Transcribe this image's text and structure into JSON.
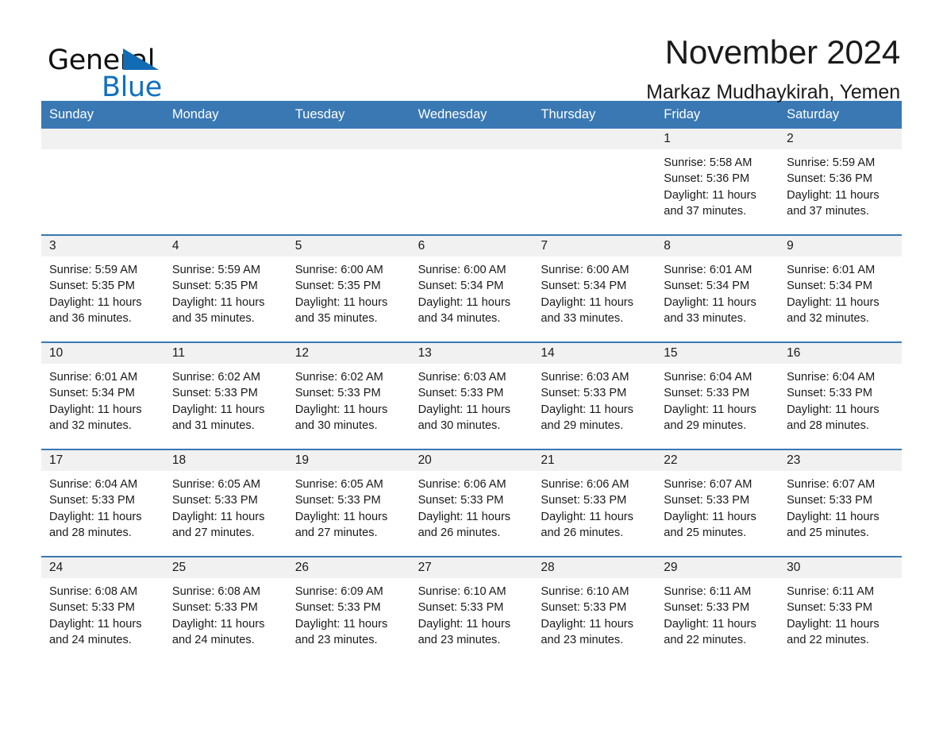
{
  "brand": {
    "word_general": "General",
    "word_blue": "Blue",
    "triangle_icon": "triangle-icon",
    "accent_color": "#126cb5"
  },
  "header": {
    "month_title": "November 2024",
    "location": "Markaz Mudhaykirah, Yemen"
  },
  "calendar": {
    "header_color": "#3a78b4",
    "weekdays": [
      "Sunday",
      "Monday",
      "Tuesday",
      "Wednesday",
      "Thursday",
      "Friday",
      "Saturday"
    ],
    "weeks": [
      [
        {
          "day": "",
          "lines": []
        },
        {
          "day": "",
          "lines": []
        },
        {
          "day": "",
          "lines": []
        },
        {
          "day": "",
          "lines": []
        },
        {
          "day": "",
          "lines": []
        },
        {
          "day": "1",
          "lines": [
            "Sunrise: 5:58 AM",
            "Sunset: 5:36 PM",
            "Daylight: 11 hours",
            "and 37 minutes."
          ]
        },
        {
          "day": "2",
          "lines": [
            "Sunrise: 5:59 AM",
            "Sunset: 5:36 PM",
            "Daylight: 11 hours",
            "and 37 minutes."
          ]
        }
      ],
      [
        {
          "day": "3",
          "lines": [
            "Sunrise: 5:59 AM",
            "Sunset: 5:35 PM",
            "Daylight: 11 hours",
            "and 36 minutes."
          ]
        },
        {
          "day": "4",
          "lines": [
            "Sunrise: 5:59 AM",
            "Sunset: 5:35 PM",
            "Daylight: 11 hours",
            "and 35 minutes."
          ]
        },
        {
          "day": "5",
          "lines": [
            "Sunrise: 6:00 AM",
            "Sunset: 5:35 PM",
            "Daylight: 11 hours",
            "and 35 minutes."
          ]
        },
        {
          "day": "6",
          "lines": [
            "Sunrise: 6:00 AM",
            "Sunset: 5:34 PM",
            "Daylight: 11 hours",
            "and 34 minutes."
          ]
        },
        {
          "day": "7",
          "lines": [
            "Sunrise: 6:00 AM",
            "Sunset: 5:34 PM",
            "Daylight: 11 hours",
            "and 33 minutes."
          ]
        },
        {
          "day": "8",
          "lines": [
            "Sunrise: 6:01 AM",
            "Sunset: 5:34 PM",
            "Daylight: 11 hours",
            "and 33 minutes."
          ]
        },
        {
          "day": "9",
          "lines": [
            "Sunrise: 6:01 AM",
            "Sunset: 5:34 PM",
            "Daylight: 11 hours",
            "and 32 minutes."
          ]
        }
      ],
      [
        {
          "day": "10",
          "lines": [
            "Sunrise: 6:01 AM",
            "Sunset: 5:34 PM",
            "Daylight: 11 hours",
            "and 32 minutes."
          ]
        },
        {
          "day": "11",
          "lines": [
            "Sunrise: 6:02 AM",
            "Sunset: 5:33 PM",
            "Daylight: 11 hours",
            "and 31 minutes."
          ]
        },
        {
          "day": "12",
          "lines": [
            "Sunrise: 6:02 AM",
            "Sunset: 5:33 PM",
            "Daylight: 11 hours",
            "and 30 minutes."
          ]
        },
        {
          "day": "13",
          "lines": [
            "Sunrise: 6:03 AM",
            "Sunset: 5:33 PM",
            "Daylight: 11 hours",
            "and 30 minutes."
          ]
        },
        {
          "day": "14",
          "lines": [
            "Sunrise: 6:03 AM",
            "Sunset: 5:33 PM",
            "Daylight: 11 hours",
            "and 29 minutes."
          ]
        },
        {
          "day": "15",
          "lines": [
            "Sunrise: 6:04 AM",
            "Sunset: 5:33 PM",
            "Daylight: 11 hours",
            "and 29 minutes."
          ]
        },
        {
          "day": "16",
          "lines": [
            "Sunrise: 6:04 AM",
            "Sunset: 5:33 PM",
            "Daylight: 11 hours",
            "and 28 minutes."
          ]
        }
      ],
      [
        {
          "day": "17",
          "lines": [
            "Sunrise: 6:04 AM",
            "Sunset: 5:33 PM",
            "Daylight: 11 hours",
            "and 28 minutes."
          ]
        },
        {
          "day": "18",
          "lines": [
            "Sunrise: 6:05 AM",
            "Sunset: 5:33 PM",
            "Daylight: 11 hours",
            "and 27 minutes."
          ]
        },
        {
          "day": "19",
          "lines": [
            "Sunrise: 6:05 AM",
            "Sunset: 5:33 PM",
            "Daylight: 11 hours",
            "and 27 minutes."
          ]
        },
        {
          "day": "20",
          "lines": [
            "Sunrise: 6:06 AM",
            "Sunset: 5:33 PM",
            "Daylight: 11 hours",
            "and 26 minutes."
          ]
        },
        {
          "day": "21",
          "lines": [
            "Sunrise: 6:06 AM",
            "Sunset: 5:33 PM",
            "Daylight: 11 hours",
            "and 26 minutes."
          ]
        },
        {
          "day": "22",
          "lines": [
            "Sunrise: 6:07 AM",
            "Sunset: 5:33 PM",
            "Daylight: 11 hours",
            "and 25 minutes."
          ]
        },
        {
          "day": "23",
          "lines": [
            "Sunrise: 6:07 AM",
            "Sunset: 5:33 PM",
            "Daylight: 11 hours",
            "and 25 minutes."
          ]
        }
      ],
      [
        {
          "day": "24",
          "lines": [
            "Sunrise: 6:08 AM",
            "Sunset: 5:33 PM",
            "Daylight: 11 hours",
            "and 24 minutes."
          ]
        },
        {
          "day": "25",
          "lines": [
            "Sunrise: 6:08 AM",
            "Sunset: 5:33 PM",
            "Daylight: 11 hours",
            "and 24 minutes."
          ]
        },
        {
          "day": "26",
          "lines": [
            "Sunrise: 6:09 AM",
            "Sunset: 5:33 PM",
            "Daylight: 11 hours",
            "and 23 minutes."
          ]
        },
        {
          "day": "27",
          "lines": [
            "Sunrise: 6:10 AM",
            "Sunset: 5:33 PM",
            "Daylight: 11 hours",
            "and 23 minutes."
          ]
        },
        {
          "day": "28",
          "lines": [
            "Sunrise: 6:10 AM",
            "Sunset: 5:33 PM",
            "Daylight: 11 hours",
            "and 23 minutes."
          ]
        },
        {
          "day": "29",
          "lines": [
            "Sunrise: 6:11 AM",
            "Sunset: 5:33 PM",
            "Daylight: 11 hours",
            "and 22 minutes."
          ]
        },
        {
          "day": "30",
          "lines": [
            "Sunrise: 6:11 AM",
            "Sunset: 5:33 PM",
            "Daylight: 11 hours",
            "and 22 minutes."
          ]
        }
      ]
    ]
  }
}
